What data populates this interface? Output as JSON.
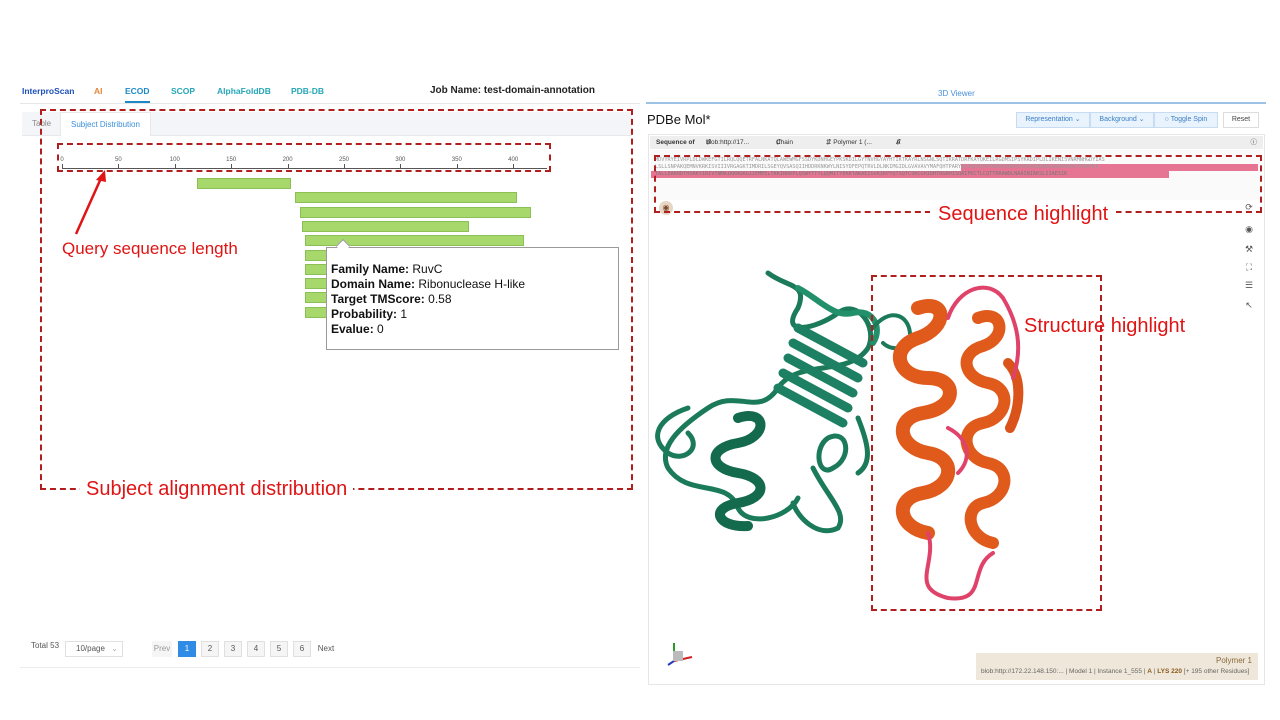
{
  "nav": {
    "tabs": [
      {
        "label": "InterproScan",
        "color": "#1a4fb8"
      },
      {
        "label": "AI",
        "color": "#e8853a"
      },
      {
        "label": "ECOD",
        "color": "#1e88c7"
      },
      {
        "label": "SCOP",
        "color": "#25a7b8"
      },
      {
        "label": "AlphaFoldDB",
        "color": "#25a7b8"
      },
      {
        "label": "PDB-DB",
        "color": "#25a7b8"
      }
    ],
    "active": "ECOD"
  },
  "job_title": "Job Name: test-domain-annotation",
  "viewer_section_title": "3D Viewer",
  "subtabs": {
    "table": "Table",
    "subject": "Subject Distribution"
  },
  "axis": {
    "ticks": [
      "0",
      "50",
      "100",
      "150",
      "200",
      "250",
      "300",
      "350",
      "400"
    ],
    "range": [
      0,
      430
    ]
  },
  "alignments": [
    {
      "start": 120,
      "end": 203
    },
    {
      "start": 207,
      "end": 403
    },
    {
      "start": 211,
      "end": 416
    },
    {
      "start": 213,
      "end": 361
    },
    {
      "start": 215,
      "end": 410
    },
    {
      "start": 215,
      "end": 393
    },
    {
      "start": 215,
      "end": 362
    },
    {
      "start": 215,
      "end": 378
    },
    {
      "start": 215,
      "end": 371
    },
    {
      "start": 215,
      "end": 355
    }
  ],
  "tooltip": {
    "family_label": "Family Name:",
    "family_value": "RuvC",
    "domain_label": "Domain Name:",
    "domain_value": "Ribonuclease H-like",
    "tm_label": "Target TMScore:",
    "tm_value": "0.58",
    "prob_label": "Probability:",
    "prob_value": "1",
    "evalue_label": "Evalue:",
    "evalue_value": "0"
  },
  "annotations": {
    "query_len": "Query sequence length",
    "subject_dist": "Subject alignment distribution",
    "seq_hl": "Sequence highlight",
    "struct_hl": "Structure highlight"
  },
  "pagination": {
    "total": "Total 53",
    "page_size": "10/page",
    "prev": "Prev",
    "pages": [
      "1",
      "2",
      "3",
      "4",
      "5",
      "6"
    ],
    "next": "Next",
    "current": "1"
  },
  "viewer": {
    "title": "PDBe Mol*",
    "representation": "Representation",
    "background": "Background",
    "toggle_spin": "Toggle Spin",
    "reset": "Reset",
    "seq_of": "Sequence of",
    "blob": "blob:http://17...",
    "chain": "Chain",
    "polymer": "1: Polymer 1 (...",
    "chain_id": "A",
    "seq_lines": [
      "MDVYRYEIVRPLDLDWKEFGTILRQLQQETRFALNKATQLAWEWMGFSSDYKDNHGEYPKSKDILGYTNVHGYAYHTIKTKAYRLNSGNLSQTIKRATDRFKAYQKEILRGDMSIPSYKRDIPLDLIKENISVNRMNHGDYIAS",
      "LSLLSNPAKQEMNVKRKISVIIIVRGAGKTIMDRILSGEYQVSASQIIHDDRKNKWYLNISYDFEPQTRVLDLNKIMGIDLGVAVAVYMAFQHTPARYKLEGGEIEKFRRQVEARRISMLRQGKNAGGARGHGRSTRIPPLE",
      "TALLEAKRDTHSRKYIRIVTNMAIKKRGKGIIEMEELTKKIRRKPLQSWYTTYLQQMITYEKKTAKAEIGVKIKPYQTSQTCSKCGHIDHTRGRHISQAIFKCTLCQTTRRAWDLNAAINIAKSLIIAESIK"
    ],
    "seq_numbers_1": [
      "11",
      "151",
      "161",
      "171",
      "181",
      "191",
      "201",
      "211",
      "221",
      "231",
      "241",
      "251",
      "261",
      "271",
      "281",
      "291",
      "301"
    ],
    "seq_numbers_2": [
      "301",
      "311",
      "321",
      "331",
      "341",
      "351",
      "361",
      "371",
      "381",
      "391",
      "401",
      "411",
      "421",
      "431"
    ],
    "status_polymer": "Polymer 1",
    "status_line": "blob:http://172.22.148.150:... | Model 1 | Instance 1_555 |",
    "status_chain": "A",
    "status_residue": "LYS 220",
    "status_more": "[+ 195 other Residues]"
  },
  "colors": {
    "bar": "#a6d86b",
    "annotation_red": "#e01414",
    "structure_green": "#1b7a5a",
    "structure_orange": "#e05a1c",
    "highlight_pink": "#e57593"
  }
}
